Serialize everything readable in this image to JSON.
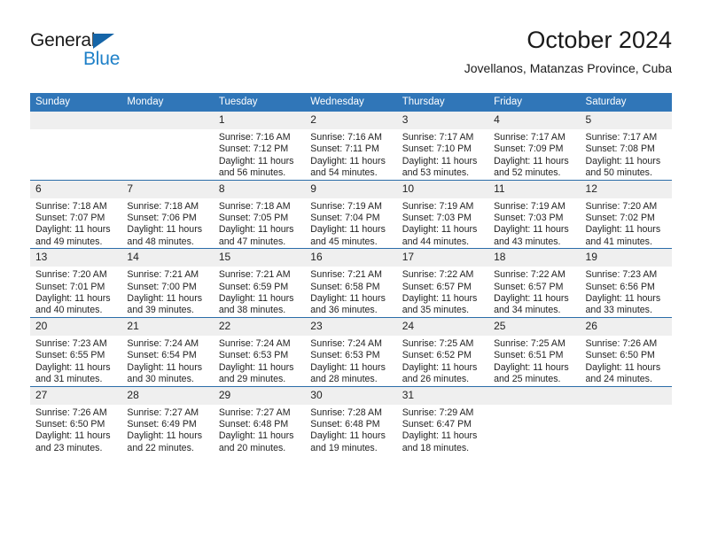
{
  "brand": {
    "name_part1": "General",
    "name_part2": "Blue",
    "accent_color": "#1e80c8",
    "triangle_color": "#1565a8"
  },
  "header": {
    "title": "October 2024",
    "location": "Jovellanos, Matanzas Province, Cuba"
  },
  "calendar": {
    "header_background": "#3076b8",
    "header_text_color": "#ffffff",
    "daynum_background": "#efefef",
    "gridline_color": "#2b6da9",
    "weekday_headers": [
      "Sunday",
      "Monday",
      "Tuesday",
      "Wednesday",
      "Thursday",
      "Friday",
      "Saturday"
    ],
    "weeks": [
      [
        {
          "day": "",
          "lines": []
        },
        {
          "day": "",
          "lines": []
        },
        {
          "day": "1",
          "lines": [
            "Sunrise: 7:16 AM",
            "Sunset: 7:12 PM",
            "Daylight: 11 hours",
            "and 56 minutes."
          ]
        },
        {
          "day": "2",
          "lines": [
            "Sunrise: 7:16 AM",
            "Sunset: 7:11 PM",
            "Daylight: 11 hours",
            "and 54 minutes."
          ]
        },
        {
          "day": "3",
          "lines": [
            "Sunrise: 7:17 AM",
            "Sunset: 7:10 PM",
            "Daylight: 11 hours",
            "and 53 minutes."
          ]
        },
        {
          "day": "4",
          "lines": [
            "Sunrise: 7:17 AM",
            "Sunset: 7:09 PM",
            "Daylight: 11 hours",
            "and 52 minutes."
          ]
        },
        {
          "day": "5",
          "lines": [
            "Sunrise: 7:17 AM",
            "Sunset: 7:08 PM",
            "Daylight: 11 hours",
            "and 50 minutes."
          ]
        }
      ],
      [
        {
          "day": "6",
          "lines": [
            "Sunrise: 7:18 AM",
            "Sunset: 7:07 PM",
            "Daylight: 11 hours",
            "and 49 minutes."
          ]
        },
        {
          "day": "7",
          "lines": [
            "Sunrise: 7:18 AM",
            "Sunset: 7:06 PM",
            "Daylight: 11 hours",
            "and 48 minutes."
          ]
        },
        {
          "day": "8",
          "lines": [
            "Sunrise: 7:18 AM",
            "Sunset: 7:05 PM",
            "Daylight: 11 hours",
            "and 47 minutes."
          ]
        },
        {
          "day": "9",
          "lines": [
            "Sunrise: 7:19 AM",
            "Sunset: 7:04 PM",
            "Daylight: 11 hours",
            "and 45 minutes."
          ]
        },
        {
          "day": "10",
          "lines": [
            "Sunrise: 7:19 AM",
            "Sunset: 7:03 PM",
            "Daylight: 11 hours",
            "and 44 minutes."
          ]
        },
        {
          "day": "11",
          "lines": [
            "Sunrise: 7:19 AM",
            "Sunset: 7:03 PM",
            "Daylight: 11 hours",
            "and 43 minutes."
          ]
        },
        {
          "day": "12",
          "lines": [
            "Sunrise: 7:20 AM",
            "Sunset: 7:02 PM",
            "Daylight: 11 hours",
            "and 41 minutes."
          ]
        }
      ],
      [
        {
          "day": "13",
          "lines": [
            "Sunrise: 7:20 AM",
            "Sunset: 7:01 PM",
            "Daylight: 11 hours",
            "and 40 minutes."
          ]
        },
        {
          "day": "14",
          "lines": [
            "Sunrise: 7:21 AM",
            "Sunset: 7:00 PM",
            "Daylight: 11 hours",
            "and 39 minutes."
          ]
        },
        {
          "day": "15",
          "lines": [
            "Sunrise: 7:21 AM",
            "Sunset: 6:59 PM",
            "Daylight: 11 hours",
            "and 38 minutes."
          ]
        },
        {
          "day": "16",
          "lines": [
            "Sunrise: 7:21 AM",
            "Sunset: 6:58 PM",
            "Daylight: 11 hours",
            "and 36 minutes."
          ]
        },
        {
          "day": "17",
          "lines": [
            "Sunrise: 7:22 AM",
            "Sunset: 6:57 PM",
            "Daylight: 11 hours",
            "and 35 minutes."
          ]
        },
        {
          "day": "18",
          "lines": [
            "Sunrise: 7:22 AM",
            "Sunset: 6:57 PM",
            "Daylight: 11 hours",
            "and 34 minutes."
          ]
        },
        {
          "day": "19",
          "lines": [
            "Sunrise: 7:23 AM",
            "Sunset: 6:56 PM",
            "Daylight: 11 hours",
            "and 33 minutes."
          ]
        }
      ],
      [
        {
          "day": "20",
          "lines": [
            "Sunrise: 7:23 AM",
            "Sunset: 6:55 PM",
            "Daylight: 11 hours",
            "and 31 minutes."
          ]
        },
        {
          "day": "21",
          "lines": [
            "Sunrise: 7:24 AM",
            "Sunset: 6:54 PM",
            "Daylight: 11 hours",
            "and 30 minutes."
          ]
        },
        {
          "day": "22",
          "lines": [
            "Sunrise: 7:24 AM",
            "Sunset: 6:53 PM",
            "Daylight: 11 hours",
            "and 29 minutes."
          ]
        },
        {
          "day": "23",
          "lines": [
            "Sunrise: 7:24 AM",
            "Sunset: 6:53 PM",
            "Daylight: 11 hours",
            "and 28 minutes."
          ]
        },
        {
          "day": "24",
          "lines": [
            "Sunrise: 7:25 AM",
            "Sunset: 6:52 PM",
            "Daylight: 11 hours",
            "and 26 minutes."
          ]
        },
        {
          "day": "25",
          "lines": [
            "Sunrise: 7:25 AM",
            "Sunset: 6:51 PM",
            "Daylight: 11 hours",
            "and 25 minutes."
          ]
        },
        {
          "day": "26",
          "lines": [
            "Sunrise: 7:26 AM",
            "Sunset: 6:50 PM",
            "Daylight: 11 hours",
            "and 24 minutes."
          ]
        }
      ],
      [
        {
          "day": "27",
          "lines": [
            "Sunrise: 7:26 AM",
            "Sunset: 6:50 PM",
            "Daylight: 11 hours",
            "and 23 minutes."
          ]
        },
        {
          "day": "28",
          "lines": [
            "Sunrise: 7:27 AM",
            "Sunset: 6:49 PM",
            "Daylight: 11 hours",
            "and 22 minutes."
          ]
        },
        {
          "day": "29",
          "lines": [
            "Sunrise: 7:27 AM",
            "Sunset: 6:48 PM",
            "Daylight: 11 hours",
            "and 20 minutes."
          ]
        },
        {
          "day": "30",
          "lines": [
            "Sunrise: 7:28 AM",
            "Sunset: 6:48 PM",
            "Daylight: 11 hours",
            "and 19 minutes."
          ]
        },
        {
          "day": "31",
          "lines": [
            "Sunrise: 7:29 AM",
            "Sunset: 6:47 PM",
            "Daylight: 11 hours",
            "and 18 minutes."
          ]
        },
        {
          "day": "",
          "lines": []
        },
        {
          "day": "",
          "lines": []
        }
      ]
    ]
  }
}
